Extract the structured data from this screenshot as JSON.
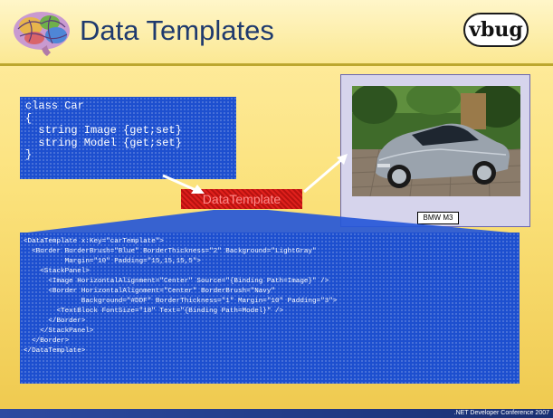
{
  "slide": {
    "title": "Data Templates",
    "logo_text": "vbug",
    "class_code": "class Car\n{\n  string Image {get;set}\n  string Model {get;set}\n}",
    "template_label": "DataTemplate",
    "template_code": "<DataTemplate x:Key=\"carTemplate\">\n  <Border BorderBrush=\"Blue\" BorderThickness=\"2\" Background=\"LightGray\"\n          Margin=\"10\" Padding=\"15,15,15,5\">\n    <StackPanel>\n      <Image HorizontalAlignment=\"Center\" Source=\"{Binding Path=Image}\" />\n      <Border HorizontalAlignment=\"Center\" BorderBrush=\"Navy\"\n              Background=\"#DDF\" BorderThickness=\"1\" Margin=\"10\" Padding=\"3\">\n        <TextBlock FontSize=\"18\" Text=\"{Binding Path=Model}\" />\n      </Border>\n    </StackPanel>\n  </Border>\n</DataTemplate>",
    "car_label": "BMW M3",
    "footer": ".NET Developer Conference 2007"
  },
  "colors": {
    "code_background": "#1d4fcf",
    "title_text": "#1f3a6e",
    "template_label_background": "#e0201c",
    "footer_bar": "#2d4ba0"
  },
  "icons": {
    "left_logo": "brain-icon",
    "right_logo": "vbug-logo"
  }
}
